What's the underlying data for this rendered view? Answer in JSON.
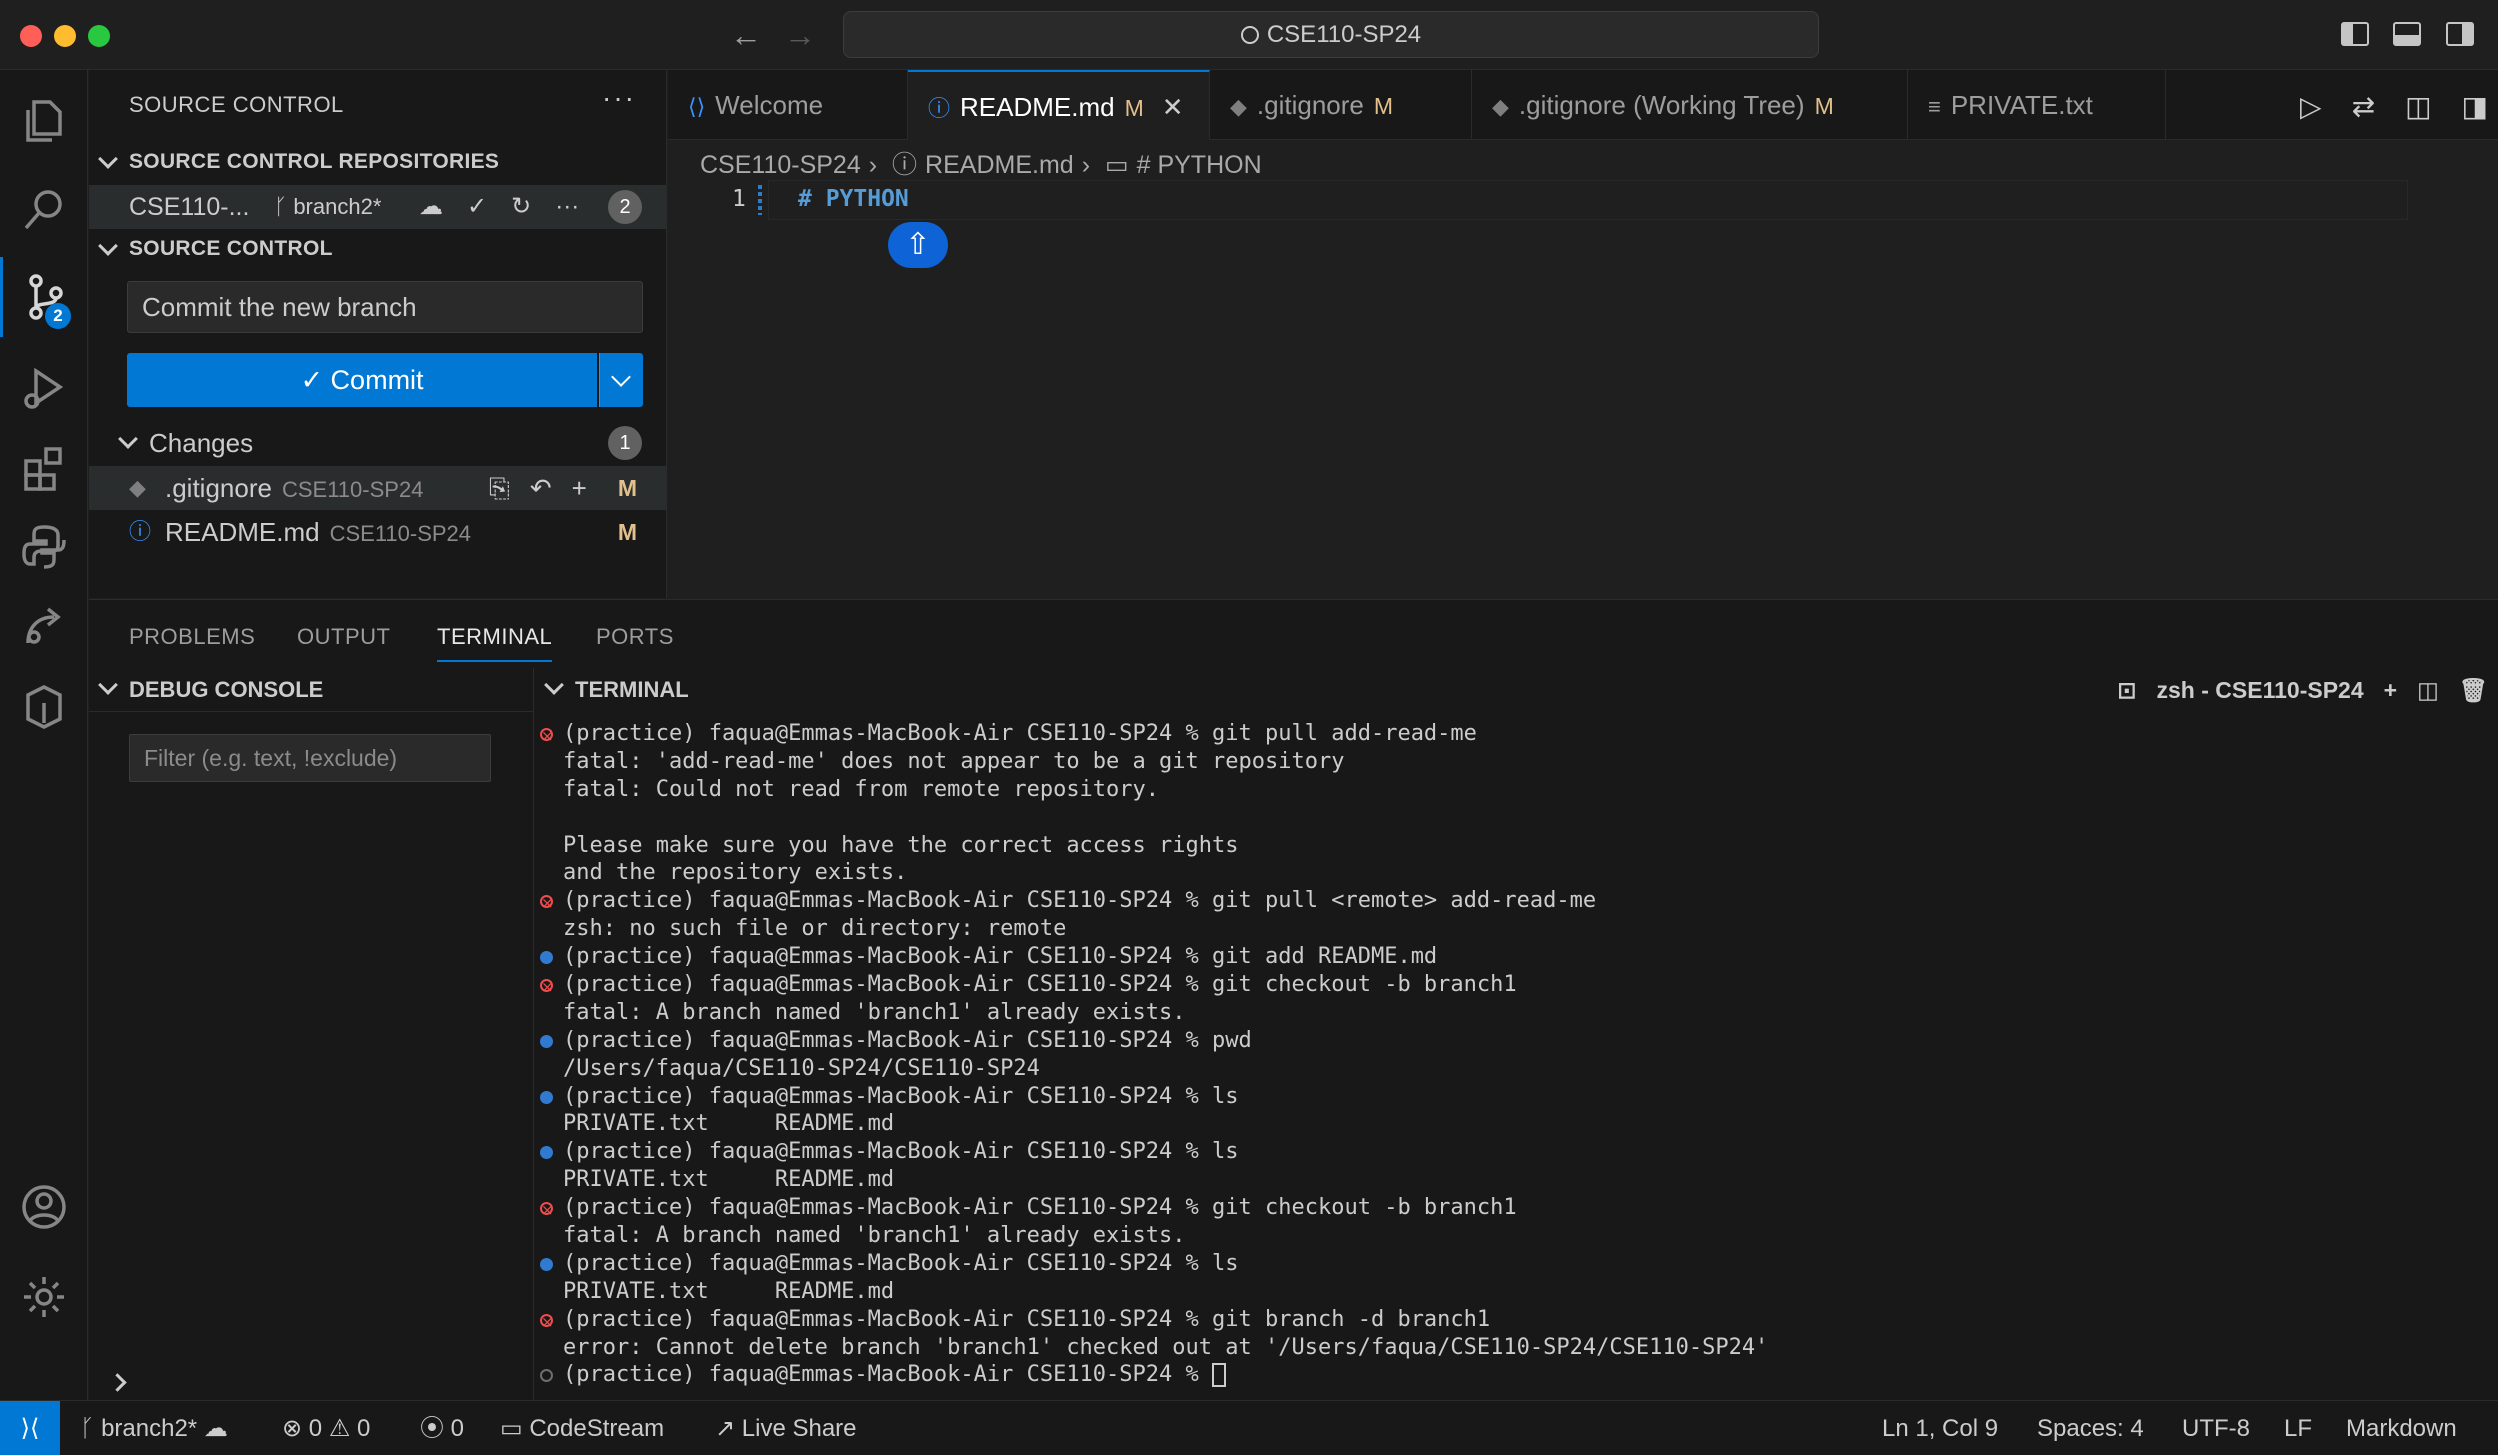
{
  "title_bar": {
    "search_text": "CSE110-SP24"
  },
  "activity_bar": {
    "scm_badge": "2"
  },
  "sidebar": {
    "title": "SOURCE CONTROL",
    "more": "···",
    "repos_header": "SOURCE CONTROL REPOSITORIES",
    "repo": {
      "name": "CSE110-...",
      "branch": "branch2*",
      "count": "2"
    },
    "scm_header": "SOURCE CONTROL",
    "commit_message": "Commit the new branch",
    "commit_label": "✓ Commit",
    "changes_label": "Changes",
    "changes_count": "1",
    "files": [
      {
        "name": ".gitignore",
        "dir": "CSE110-SP24",
        "status": "M"
      },
      {
        "name": "README.md",
        "dir": "CSE110-SP24",
        "status": "M"
      }
    ]
  },
  "editor": {
    "tabs": [
      {
        "label": "Welcome",
        "status": ""
      },
      {
        "label": "README.md",
        "status": "M"
      },
      {
        "label": ".gitignore",
        "status": "M"
      },
      {
        "label": ".gitignore (Working Tree)",
        "status": "M"
      },
      {
        "label": "PRIVATE.txt",
        "status": ""
      }
    ],
    "breadcrumb": [
      "CSE110-SP24",
      "README.md",
      "# PYTHON"
    ],
    "line_number": "1",
    "code": "# PYTHON"
  },
  "panel": {
    "tabs": [
      "PROBLEMS",
      "OUTPUT",
      "TERMINAL",
      "PORTS"
    ],
    "debug_header": "DEBUG CONSOLE",
    "debug_filter_placeholder": "Filter (e.g. text, !exclude)",
    "terminal_header": "TERMINAL",
    "terminal_name": "zsh - CSE110-SP24",
    "terminal_lines": [
      {
        "mark": "err",
        "text": "(practice) faqua@Emmas-MacBook-Air CSE110-SP24 % git pull add-read-me"
      },
      {
        "mark": "",
        "text": "fatal: 'add-read-me' does not appear to be a git repository"
      },
      {
        "mark": "",
        "text": "fatal: Could not read from remote repository."
      },
      {
        "mark": "",
        "text": ""
      },
      {
        "mark": "",
        "text": "Please make sure you have the correct access rights"
      },
      {
        "mark": "",
        "text": "and the repository exists."
      },
      {
        "mark": "err",
        "text": "(practice) faqua@Emmas-MacBook-Air CSE110-SP24 % git pull <remote> add-read-me"
      },
      {
        "mark": "",
        "text": "zsh: no such file or directory: remote"
      },
      {
        "mark": "ok",
        "text": "(practice) faqua@Emmas-MacBook-Air CSE110-SP24 % git add README.md"
      },
      {
        "mark": "err",
        "text": "(practice) faqua@Emmas-MacBook-Air CSE110-SP24 % git checkout -b branch1"
      },
      {
        "mark": "",
        "text": "fatal: A branch named 'branch1' already exists."
      },
      {
        "mark": "ok",
        "text": "(practice) faqua@Emmas-MacBook-Air CSE110-SP24 % pwd"
      },
      {
        "mark": "",
        "text": "/Users/faqua/CSE110-SP24/CSE110-SP24"
      },
      {
        "mark": "ok",
        "text": "(practice) faqua@Emmas-MacBook-Air CSE110-SP24 % ls"
      },
      {
        "mark": "",
        "text": "PRIVATE.txt     README.md"
      },
      {
        "mark": "ok",
        "text": "(practice) faqua@Emmas-MacBook-Air CSE110-SP24 % ls"
      },
      {
        "mark": "",
        "text": "PRIVATE.txt     README.md"
      },
      {
        "mark": "err",
        "text": "(practice) faqua@Emmas-MacBook-Air CSE110-SP24 % git checkout -b branch1"
      },
      {
        "mark": "",
        "text": "fatal: A branch named 'branch1' already exists."
      },
      {
        "mark": "ok",
        "text": "(practice) faqua@Emmas-MacBook-Air CSE110-SP24 % ls"
      },
      {
        "mark": "",
        "text": "PRIVATE.txt     README.md"
      },
      {
        "mark": "err",
        "text": "(practice) faqua@Emmas-MacBook-Air CSE110-SP24 % git branch -d branch1"
      },
      {
        "mark": "",
        "text": "error: Cannot delete branch 'branch1' checked out at '/Users/faqua/CSE110-SP24/CSE110-SP24'"
      },
      {
        "mark": "idle",
        "text": "(practice) faqua@Emmas-MacBook-Air CSE110-SP24 % "
      }
    ]
  },
  "status_bar": {
    "branch": "branch2*",
    "errors": "0",
    "warnings": "0",
    "ports": "0",
    "codestream": "CodeStream",
    "liveshare": "Live Share",
    "position": "Ln 1, Col 9",
    "spaces": "Spaces: 4",
    "encoding": "UTF-8",
    "eol": "LF",
    "language": "Markdown"
  },
  "colors": {
    "accent": "#0078d4",
    "modified": "#e2c08d",
    "error": "#f14c4c"
  }
}
